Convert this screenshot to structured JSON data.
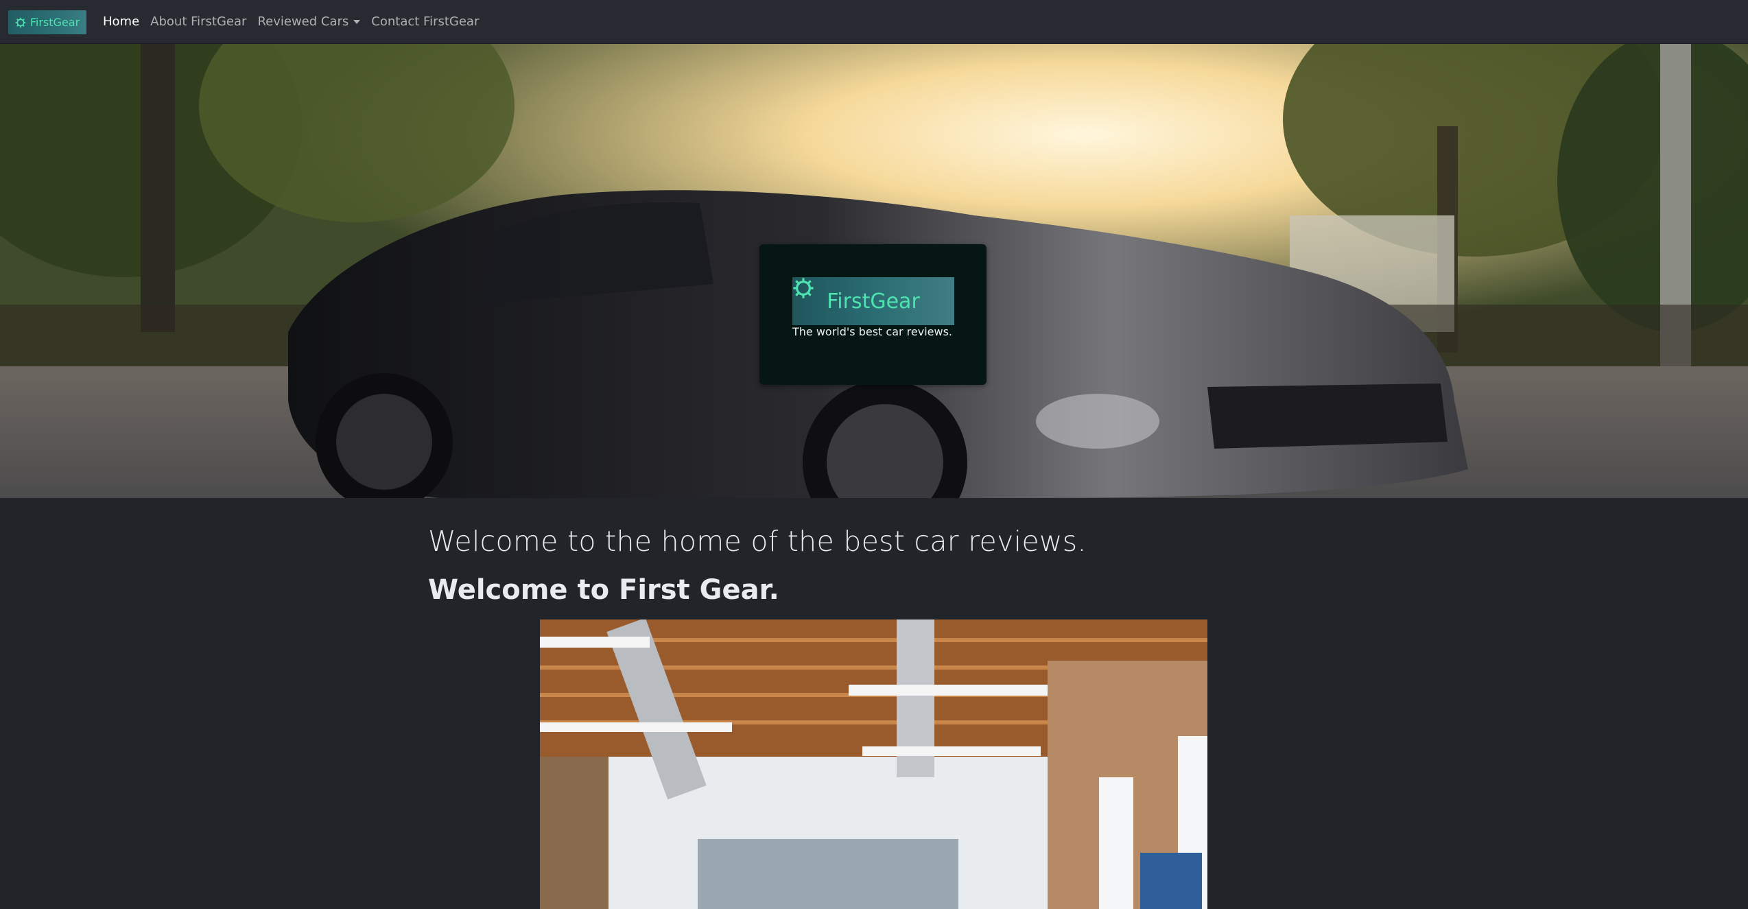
{
  "navbar": {
    "brand_label": "FirstGear",
    "links": [
      {
        "label": "Home",
        "active": true
      },
      {
        "label": "About FirstGear",
        "active": false
      },
      {
        "label": "Reviewed Cars",
        "active": false,
        "dropdown": true
      },
      {
        "label": "Contact FirstGear",
        "active": false
      }
    ]
  },
  "hero": {
    "logo_label": "FirstGear",
    "tagline": "The world's best car reviews."
  },
  "main": {
    "headline": "Welcome to the home of the best car reviews.",
    "subheadline": "Welcome to First Gear."
  },
  "colors": {
    "accent": "#4fe3b0",
    "background": "#212529",
    "navbar": "#272b31",
    "card": "#061713"
  },
  "icons": {
    "brand": "gear-icon",
    "dropdown": "caret-down-icon"
  }
}
